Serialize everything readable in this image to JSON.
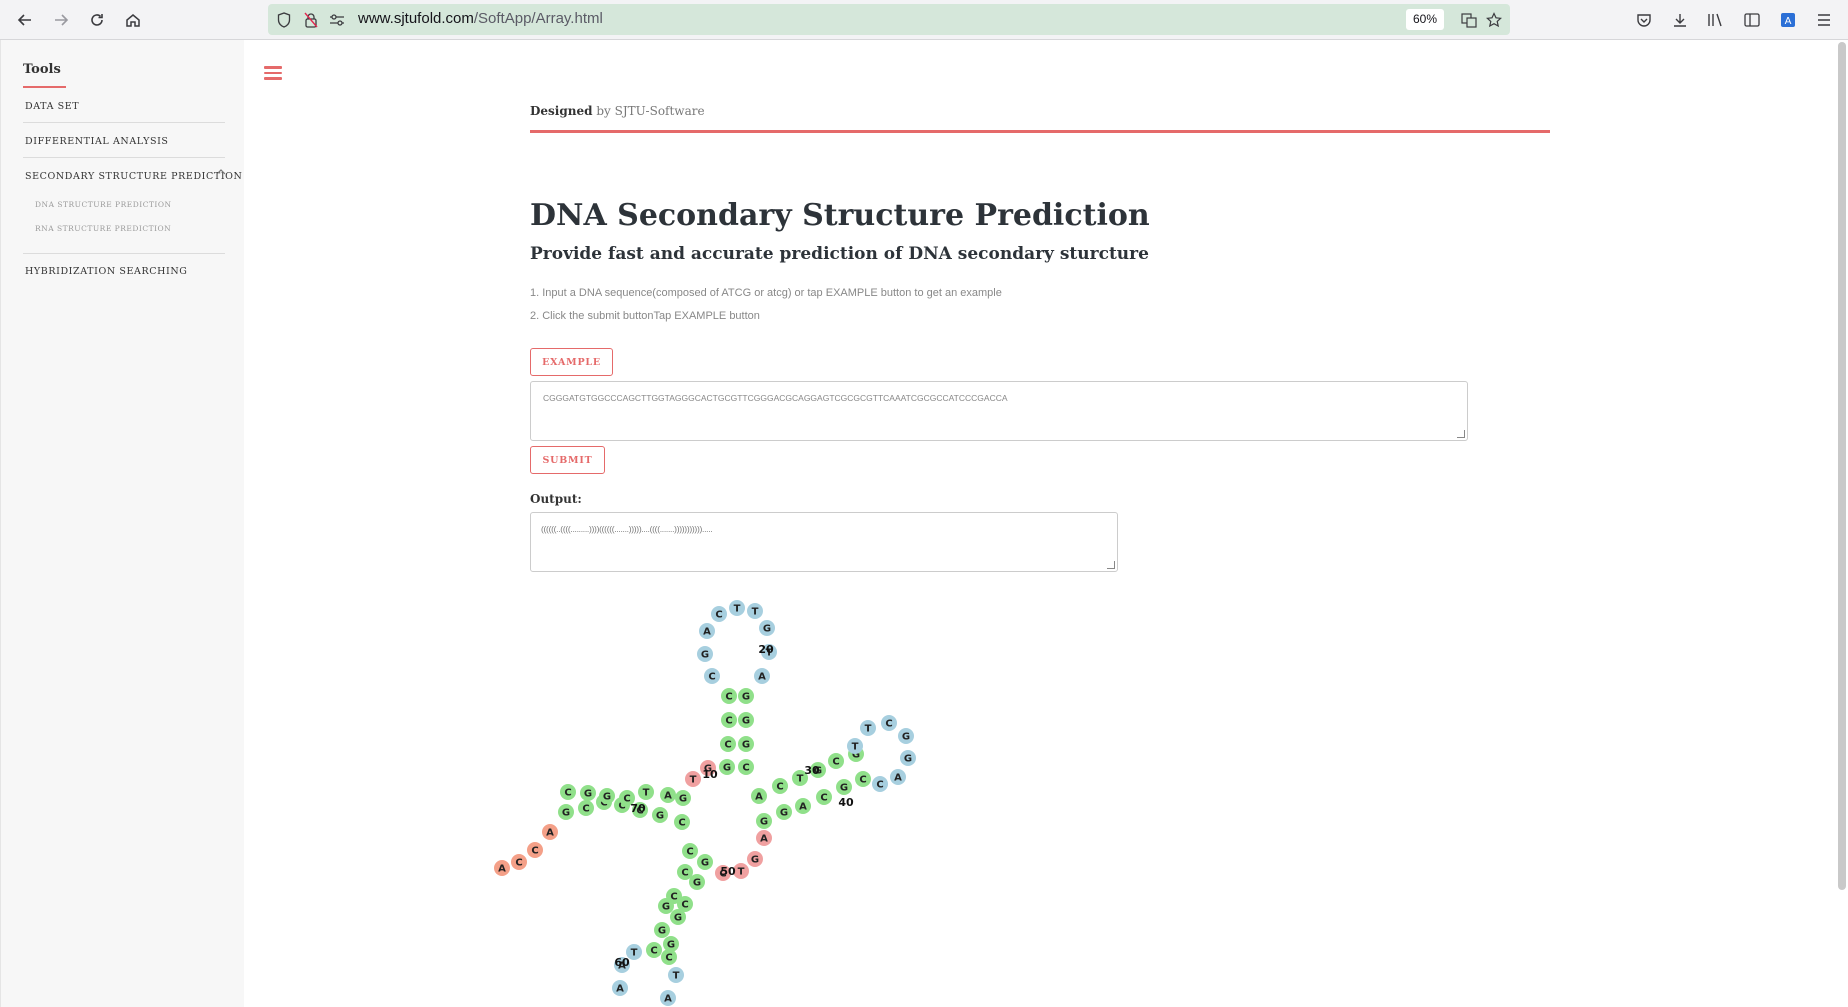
{
  "browser": {
    "url_domain": "www.sjtufold.com",
    "url_path": "/SoftApp/Array.html",
    "zoom": "60%"
  },
  "sidebar": {
    "title": "Tools",
    "items": [
      {
        "label": "DATA SET"
      },
      {
        "label": "DIFFERENTIAL ANALYSIS"
      },
      {
        "label": "SECONDARY STRUCTURE PREDICTION"
      },
      {
        "label": "HYBRIDIZATION SEARCHING"
      }
    ],
    "subitems": [
      {
        "label": "DNA STRUCTURE PREDICTION"
      },
      {
        "label": "RNA STRUCTURE PREDICTION"
      }
    ]
  },
  "header": {
    "designed_bold": "Designed",
    "designed_rest": "by SJTU-Software"
  },
  "content": {
    "title": "DNA Secondary Structure Prediction",
    "subtitle": "Provide fast and accurate prediction of DNA secondary sturcture",
    "step1": "1. Input a DNA sequence(composed of ATCG or atcg) or tap EXAMPLE button to get an example",
    "step2": "2. Click the submit buttonTap EXAMPLE button",
    "example_button": "EXAMPLE",
    "sequence": "CGGGATGTGGCCCAGCTTGGTAGGGCACTGCGTTCGGGACGCAGGAGTCGCGCGTTCAAATCGCGCCATCCCGACCA",
    "submit_button": "SUBMIT",
    "output_label": "Output:",
    "output_value": "((((((..((((.........))))((((((.......)))))....((((.......)))))))))))....."
  },
  "colors": {
    "accent": "#e56a6a",
    "stem": "#90e08a",
    "loop": "#a7cfdf",
    "unpaired_end": "#f0a0a0",
    "tail": "#f4a088"
  },
  "structure_nucleotides": [
    "A",
    "C",
    "C",
    "A",
    "G",
    "C",
    "C",
    "C",
    "T",
    "A",
    "C",
    "G",
    "G",
    "C",
    "C",
    "G",
    "G",
    "G",
    "T",
    "T",
    "C",
    "C",
    "A",
    "G",
    "T",
    "T",
    "G",
    "C",
    "A",
    "A",
    "G",
    "G",
    "C",
    "G",
    "C",
    "A",
    "T",
    "C",
    "C",
    "G",
    "G",
    "A",
    "G",
    "T",
    "C",
    "G",
    "C",
    "C",
    "G",
    "G",
    "C",
    "C",
    "G",
    "T",
    "C",
    "G",
    "G",
    "A",
    "T",
    "G",
    "T",
    "A",
    "G",
    "C",
    "A",
    "C",
    "T",
    "C",
    "C",
    "G",
    "A",
    "G",
    "C",
    "G",
    "A",
    "C",
    "C"
  ],
  "structure_index_labels": [
    "10",
    "20",
    "30",
    "40",
    "50",
    "60",
    "70"
  ]
}
